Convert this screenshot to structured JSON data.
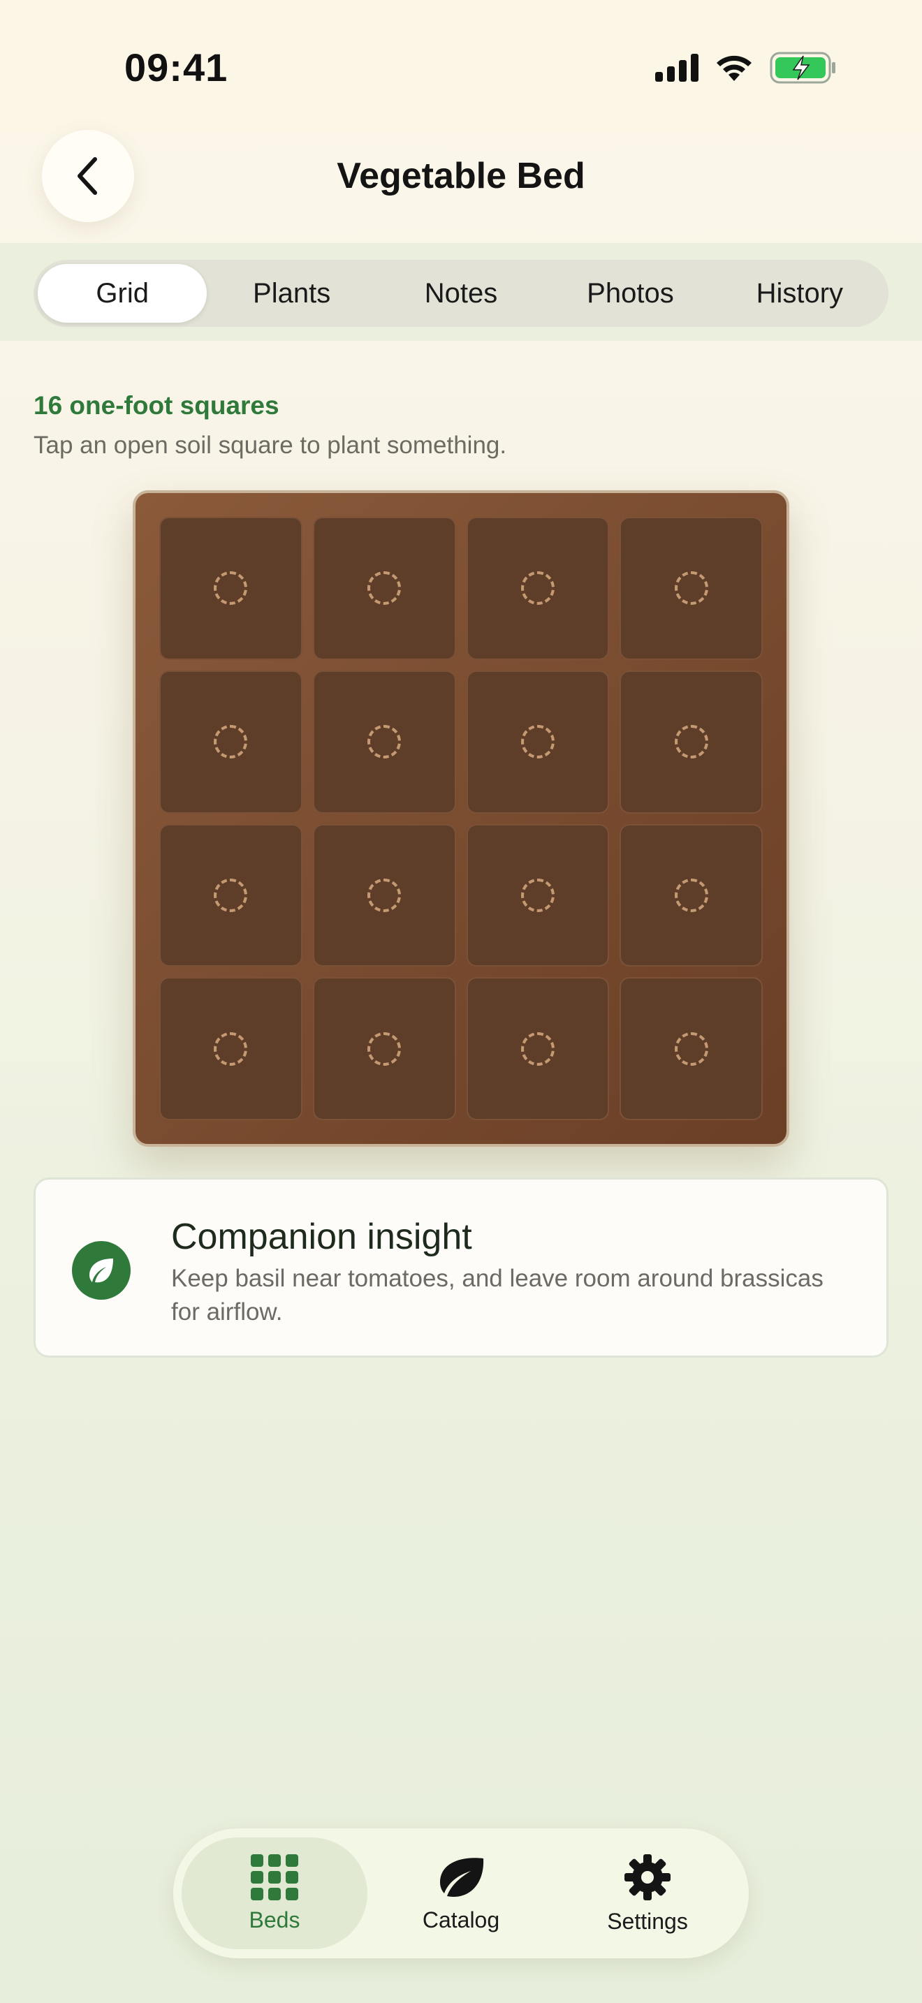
{
  "status_bar": {
    "time": "09:41",
    "icons": [
      "cellular-signal-icon",
      "wifi-icon",
      "battery-charging-icon"
    ]
  },
  "header": {
    "title": "Vegetable Bed",
    "back_icon": "chevron-left-icon"
  },
  "tabs": [
    {
      "label": "Grid",
      "active": true
    },
    {
      "label": "Plants",
      "active": false
    },
    {
      "label": "Notes",
      "active": false
    },
    {
      "label": "Photos",
      "active": false
    },
    {
      "label": "History",
      "active": false
    }
  ],
  "bed_info": {
    "title": "16 one-foot squares",
    "subtitle": "Tap an open soil square to plant something."
  },
  "bed_grid": {
    "rows": 4,
    "columns": 4,
    "cell_state": "open-soil"
  },
  "insight": {
    "icon": "leaf-icon",
    "title": "Companion insight",
    "body": "Keep basil near tomatoes, and leave room around brassicas for airflow."
  },
  "tabbar": [
    {
      "label": "Beds",
      "icon": "grid-icon",
      "active": true
    },
    {
      "label": "Catalog",
      "icon": "leaf-icon",
      "active": false
    },
    {
      "label": "Settings",
      "icon": "gear-icon",
      "active": false
    }
  ],
  "colors": {
    "accent": "#2f7a3b",
    "soil": "#5e3e29",
    "bed_frame": "#8a5a3a"
  }
}
